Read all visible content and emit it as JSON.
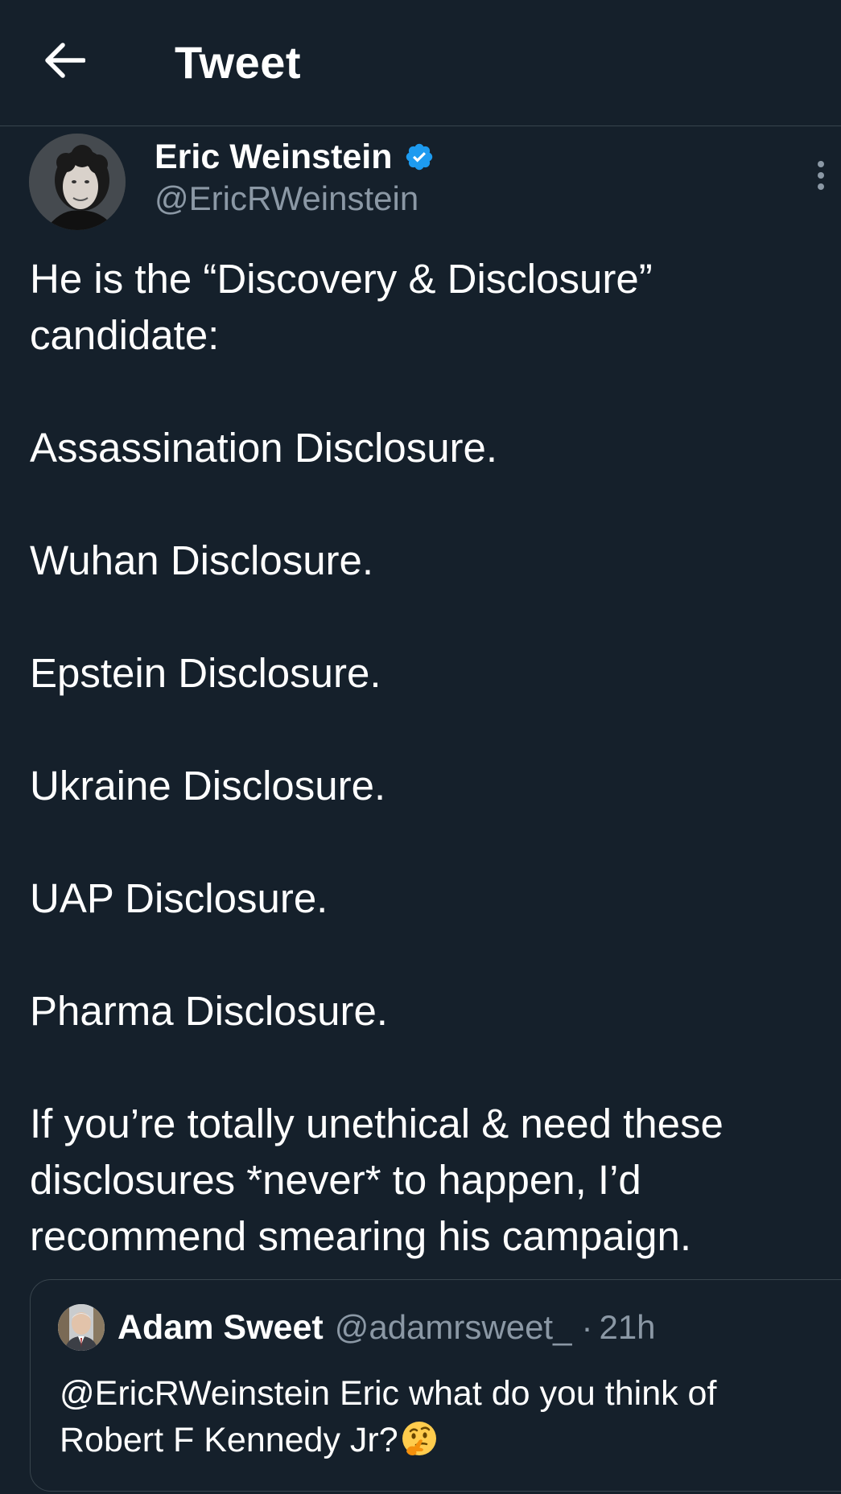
{
  "header": {
    "title": "Tweet",
    "back_icon": "arrow-left-icon"
  },
  "tweet": {
    "author": {
      "name": "Eric Weinstein",
      "handle": "@EricRWeinstein",
      "verified": true,
      "verified_color": "#1d9bf0"
    },
    "lines": [
      "He is the “Discovery & Disclosure”",
      "candidate:",
      "",
      "Assassination Disclosure.",
      "",
      "Wuhan Disclosure.",
      "",
      "Epstein Disclosure.",
      "",
      "Ukraine Disclosure.",
      "",
      "UAP Disclosure.",
      "",
      "Pharma Disclosure.",
      "",
      "If you’re totally unethical & need these",
      "disclosures *never* to happen, I’d",
      "recommend smearing his campaign."
    ]
  },
  "quoted_tweet": {
    "name": "Adam Sweet",
    "handle": "@adamrsweet_",
    "separator": "·",
    "time": "21h",
    "text_line1": "@EricRWeinstein Eric what do you think of",
    "text_line2": "Robert F Kennedy Jr?",
    "emoji": "thinking-face-icon"
  },
  "colors": {
    "background": "#15202b",
    "text": "#ffffff",
    "secondary_text": "#8b98a5",
    "border": "#38444d",
    "accent": "#1d9bf0"
  }
}
